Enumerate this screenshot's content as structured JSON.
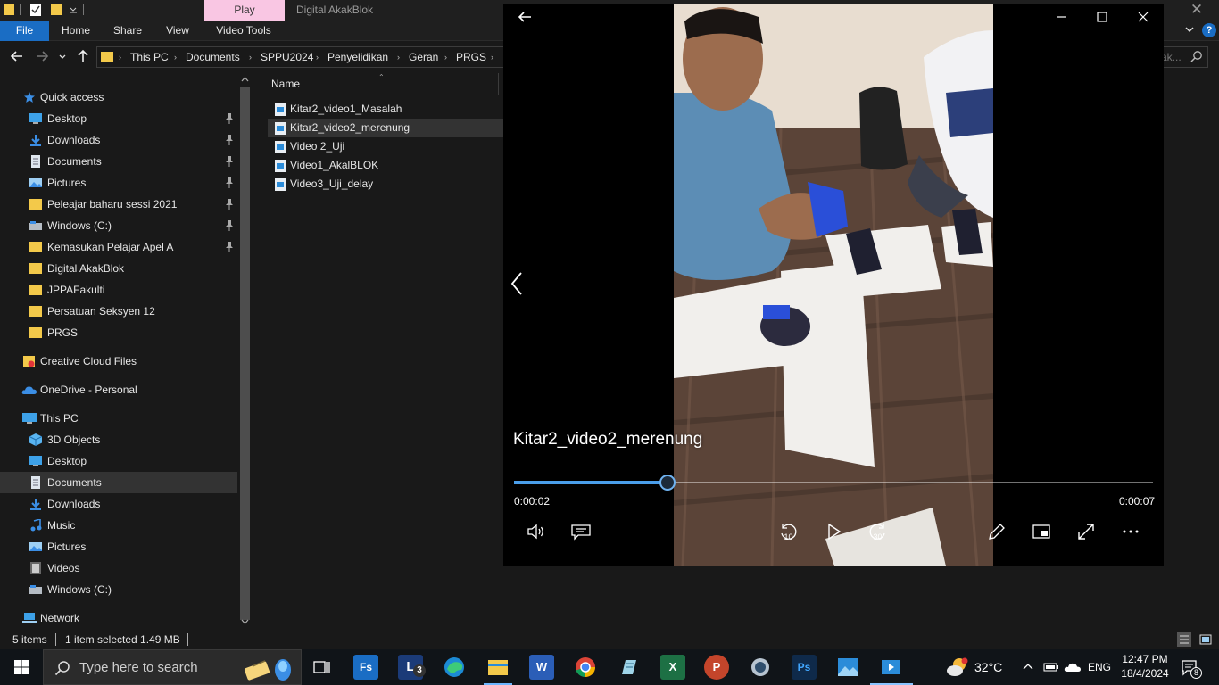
{
  "explorer": {
    "ribbon_context_tab": "Play",
    "window_title": "Digital AkakBlok",
    "close_glyph": "✕",
    "tabs": [
      "File",
      "Home",
      "Share",
      "View",
      "Video Tools"
    ],
    "breadcrumb": [
      "This PC",
      "Documents",
      "SPPU2024",
      "Penyelidikan",
      "Geran",
      "PRGS"
    ],
    "search_placeholder": "ak...",
    "column_name": "Name",
    "help_label": "?"
  },
  "nav": {
    "quick_access": "Quick access",
    "quick_items": [
      {
        "label": "Desktop",
        "icon": "desktop-icon",
        "pinned": true
      },
      {
        "label": "Downloads",
        "icon": "downloads-icon",
        "pinned": true
      },
      {
        "label": "Documents",
        "icon": "documents-icon",
        "pinned": true
      },
      {
        "label": "Pictures",
        "icon": "pictures-icon",
        "pinned": true
      },
      {
        "label": "Peleajar baharu sessi 2021",
        "icon": "folder-icon",
        "pinned": true
      },
      {
        "label": "Windows (C:)",
        "icon": "drive-icon",
        "pinned": true
      },
      {
        "label": "Kemasukan Pelajar Apel A",
        "icon": "folder-icon",
        "pinned": true
      },
      {
        "label": "Digital AkakBlok",
        "icon": "folder-icon",
        "pinned": false
      },
      {
        "label": "JPPAFakulti",
        "icon": "folder-icon",
        "pinned": false
      },
      {
        "label": "Persatuan Seksyen 12",
        "icon": "folder-icon",
        "pinned": false
      },
      {
        "label": "PRGS",
        "icon": "folder-icon",
        "pinned": false
      }
    ],
    "creative_cloud": "Creative Cloud Files",
    "onedrive": "OneDrive - Personal",
    "this_pc": "This PC",
    "pc_items": [
      {
        "label": "3D Objects",
        "icon": "3d-objects-icon"
      },
      {
        "label": "Desktop",
        "icon": "desktop-icon"
      },
      {
        "label": "Documents",
        "icon": "documents-icon"
      },
      {
        "label": "Downloads",
        "icon": "downloads-icon"
      },
      {
        "label": "Music",
        "icon": "music-icon"
      },
      {
        "label": "Pictures",
        "icon": "pictures-icon"
      },
      {
        "label": "Videos",
        "icon": "videos-icon"
      },
      {
        "label": "Windows (C:)",
        "icon": "drive-icon"
      }
    ],
    "network": "Network"
  },
  "files": [
    {
      "name": "Kitar2_video1_Masalah",
      "selected": false
    },
    {
      "name": "Kitar2_video2_merenung",
      "selected": true
    },
    {
      "name": "Video 2_Uji",
      "selected": false
    },
    {
      "name": "Video1_AkalBLOK",
      "selected": false
    },
    {
      "name": "Video3_Uji_delay",
      "selected": false
    }
  ],
  "status": {
    "count": "5 items",
    "selected": "1 item selected  1.49 MB"
  },
  "player": {
    "title": "Kitar2_video2_merenung",
    "current_time": "0:00:02",
    "total_time": "0:00:07",
    "progress": 0.24,
    "skip_back_label": "10",
    "skip_forward_label": "30"
  },
  "taskbar": {
    "search_placeholder": "Type here to search",
    "temperature": "32°C",
    "language": "ENG",
    "time": "12:47 PM",
    "date": "18/4/2024",
    "notifications": "8",
    "lens_badge": "3",
    "apps": [
      {
        "name": "task-view",
        "label": ""
      },
      {
        "name": "fs-app",
        "label": "Fs"
      },
      {
        "name": "lens-app",
        "label": "L"
      },
      {
        "name": "edge-browser",
        "label": ""
      },
      {
        "name": "file-explorer",
        "label": ""
      },
      {
        "name": "word",
        "label": "W"
      },
      {
        "name": "chrome",
        "label": ""
      },
      {
        "name": "notepad-app",
        "label": ""
      },
      {
        "name": "excel",
        "label": "X"
      },
      {
        "name": "powerpoint",
        "label": "P"
      },
      {
        "name": "camera-app",
        "label": ""
      },
      {
        "name": "photoshop",
        "label": "Ps"
      },
      {
        "name": "photos-app",
        "label": ""
      },
      {
        "name": "media-player",
        "label": ""
      }
    ]
  }
}
